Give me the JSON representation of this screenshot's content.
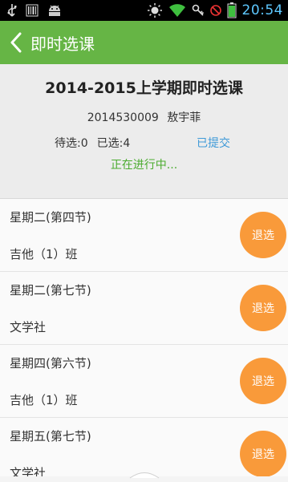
{
  "status_bar": {
    "time": "20:54",
    "icons": [
      "usb-icon",
      "barcode-icon",
      "android-icon",
      "brightness-icon",
      "wifi-icon",
      "vpn-key-icon",
      "no-sim-icon",
      "battery-icon"
    ],
    "time_color": "#5ec8ff"
  },
  "app_bar": {
    "title": "即时选课",
    "background": "#66b545"
  },
  "header": {
    "term_title": "2014-2015上学期即时选课",
    "student_id": "2014530009",
    "student_name": "敖宇菲",
    "to_select": "待选:0",
    "selected": "已选:4",
    "submit_status": "已提交",
    "progress_status": "正在进行中...",
    "submit_color": "#3f9ad8",
    "progress_color": "#4aab2e"
  },
  "courses": [
    {
      "time": "星期二(第四节)",
      "name": "吉他（1）班",
      "action": "退选"
    },
    {
      "time": "星期二(第七节)",
      "name": "文学社",
      "action": "退选"
    },
    {
      "time": "星期四(第六节)",
      "name": "吉他（1）班",
      "action": "退选"
    },
    {
      "time": "星期五(第七节)",
      "name": "文学社",
      "action": "退选"
    }
  ],
  "colors": {
    "drop_button": "#f99a3a"
  }
}
